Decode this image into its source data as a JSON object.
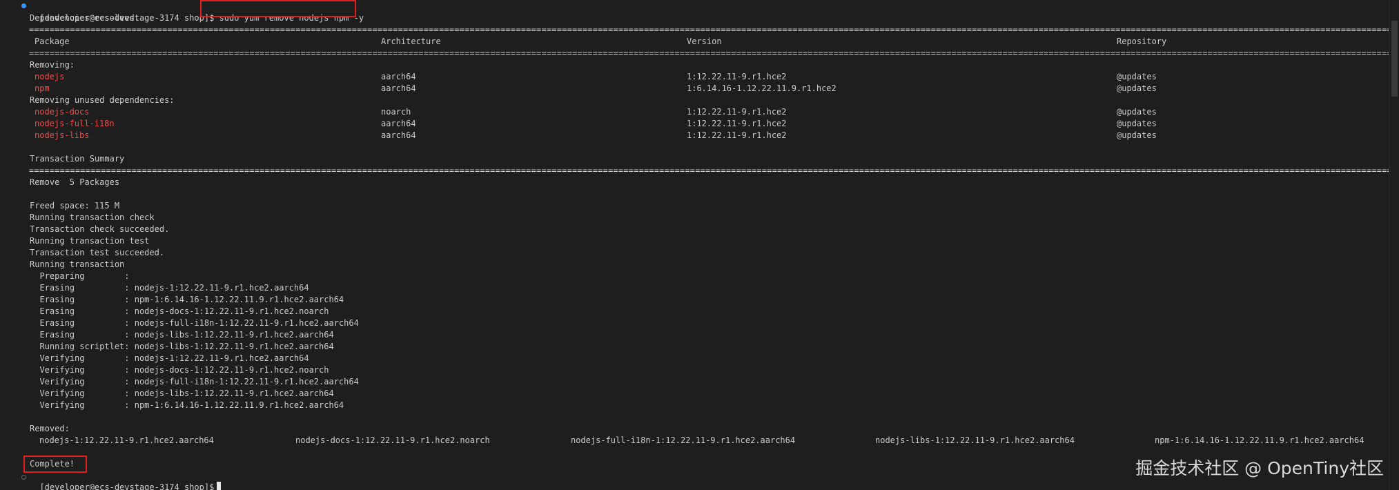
{
  "terminal": {
    "prompt_line": "[developer@ecs-devstage-3174 shop]$",
    "command": "sudo yum remove nodejs npm -y",
    "deps_resolved": "Dependencies resolved.",
    "separator": "==================================================================================================================================================================================================================================================================================================================",
    "header": {
      "package": "Package",
      "architecture": "Architecture",
      "version": "Version",
      "repository": "Repository"
    },
    "removing_label": "Removing:",
    "removing_rows": [
      {
        "package": "nodejs",
        "arch": "aarch64",
        "version": "1:12.22.11-9.r1.hce2",
        "repo": "@updates"
      },
      {
        "package": "npm",
        "arch": "aarch64",
        "version": "1:6.14.16-1.12.22.11.9.r1.hce2",
        "repo": "@updates"
      }
    ],
    "unused_label": "Removing unused dependencies:",
    "unused_rows": [
      {
        "package": "nodejs-docs",
        "arch": "noarch",
        "version": "1:12.22.11-9.r1.hce2",
        "repo": "@updates"
      },
      {
        "package": "nodejs-full-i18n",
        "arch": "aarch64",
        "version": "1:12.22.11-9.r1.hce2",
        "repo": "@updates"
      },
      {
        "package": "nodejs-libs",
        "arch": "aarch64",
        "version": "1:12.22.11-9.r1.hce2",
        "repo": "@updates"
      }
    ],
    "transaction_summary": "Transaction Summary",
    "remove_count": "Remove  5 Packages",
    "log_lines": [
      "Freed space: 115 M",
      "Running transaction check",
      "Transaction check succeeded.",
      "Running transaction test",
      "Transaction test succeeded.",
      "Running transaction",
      "  Preparing        :",
      "  Erasing          : nodejs-1:12.22.11-9.r1.hce2.aarch64",
      "  Erasing          : npm-1:6.14.16-1.12.22.11.9.r1.hce2.aarch64",
      "  Erasing          : nodejs-docs-1:12.22.11-9.r1.hce2.noarch",
      "  Erasing          : nodejs-full-i18n-1:12.22.11-9.r1.hce2.aarch64",
      "  Erasing          : nodejs-libs-1:12.22.11-9.r1.hce2.aarch64",
      "  Running scriptlet: nodejs-libs-1:12.22.11-9.r1.hce2.aarch64",
      "  Verifying        : nodejs-1:12.22.11-9.r1.hce2.aarch64",
      "  Verifying        : nodejs-docs-1:12.22.11-9.r1.hce2.noarch",
      "  Verifying        : nodejs-full-i18n-1:12.22.11-9.r1.hce2.aarch64",
      "  Verifying        : nodejs-libs-1:12.22.11-9.r1.hce2.aarch64",
      "  Verifying        : npm-1:6.14.16-1.12.22.11.9.r1.hce2.aarch64"
    ],
    "removed_label": "Removed:",
    "removed_items": [
      "nodejs-1:12.22.11-9.r1.hce2.aarch64",
      "nodejs-docs-1:12.22.11-9.r1.hce2.noarch",
      "nodejs-full-i18n-1:12.22.11-9.r1.hce2.aarch64",
      "nodejs-libs-1:12.22.11-9.r1.hce2.aarch64",
      "npm-1:6.14.16-1.12.22.11.9.r1.hce2.aarch64"
    ],
    "complete": "Complete!",
    "final_prompt": "[developer@ecs-devstage-3174 shop]$"
  },
  "watermark": "掘金技术社区 @ OpenTiny社区",
  "colors": {
    "background": "#1e1e1e",
    "text": "#cccccc",
    "package_name": "#f14c4c",
    "highlight_border": "#e02020",
    "gutter_dot_active": "#3794ff",
    "gutter_dot_idle": "#6a6a6a"
  }
}
